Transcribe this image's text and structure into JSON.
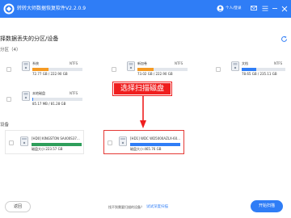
{
  "app": {
    "title": "转转大师数据恢复软件V2.2.0.9",
    "user_label": "个人/登录",
    "colors": {
      "brand": "#2f7df6",
      "accent_orange": "#f59a23",
      "accent_green": "#2e9e5b",
      "highlight": "#e53935"
    }
  },
  "page": {
    "title": "择数据丢失的分区/设备",
    "partitions_label": "分区（4）",
    "devices_label": "设备"
  },
  "partitions": [
    {
      "name": "系统",
      "fs": "NTFS",
      "size": "72.77 GB / 222.90 GB",
      "used_fraction": 0.33,
      "bar_color": "#f59a23"
    },
    {
      "name": "新加卷",
      "fs": "NTFS",
      "size": "73.02 GB / 222.90 GB",
      "used_fraction": 0.33,
      "bar_color": "#f59a23"
    },
    {
      "name": "文档",
      "fs": "NTFS",
      "size": "78.65 GB / 235.11 GB",
      "used_fraction": 0.33,
      "bar_color": "#2f7df6"
    },
    {
      "name": "本地磁盘",
      "fs": "NTFS",
      "size": "85.17 MB / 81.28 GB",
      "used_fraction": 0.01,
      "bar_color": "#2f7df6"
    }
  ],
  "devices": [
    {
      "name": "[HD0] KINGSTON SA400S37...",
      "size": "磁盘大小:223.57 GB",
      "used_fraction": 1.0,
      "bar_color": "#2e9e5b"
    },
    {
      "name": "[HD1] WDC WD5000AZLX-60...",
      "size": "磁盘大小:465.76 GB",
      "used_fraction": 1.0,
      "bar_color": "#2f7df6"
    }
  ],
  "annotation": {
    "text": "选择扫描磁盘"
  },
  "footer": {
    "back_label": "返回",
    "hint": "找不到需要扫描的设备？",
    "hint_link": "试试深度扫描",
    "start_label": "开始扫描"
  }
}
